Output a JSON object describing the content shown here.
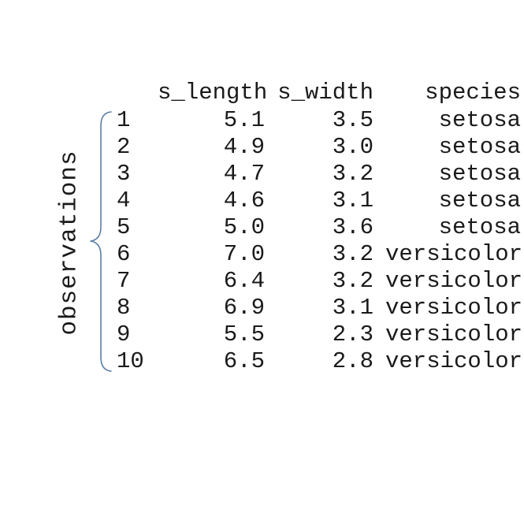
{
  "side_label": "observations",
  "columns": {
    "s_length": "s_length",
    "s_width": "s_width",
    "species": "species"
  },
  "rows": [
    {
      "index": "1",
      "s_length": "5.1",
      "s_width": "3.5",
      "species": "setosa"
    },
    {
      "index": "2",
      "s_length": "4.9",
      "s_width": "3.0",
      "species": "setosa"
    },
    {
      "index": "3",
      "s_length": "4.7",
      "s_width": "3.2",
      "species": "setosa"
    },
    {
      "index": "4",
      "s_length": "4.6",
      "s_width": "3.1",
      "species": "setosa"
    },
    {
      "index": "5",
      "s_length": "5.0",
      "s_width": "3.6",
      "species": "setosa"
    },
    {
      "index": "6",
      "s_length": "7.0",
      "s_width": "3.2",
      "species": "versicolor"
    },
    {
      "index": "7",
      "s_length": "6.4",
      "s_width": "3.2",
      "species": "versicolor"
    },
    {
      "index": "8",
      "s_length": "6.9",
      "s_width": "3.1",
      "species": "versicolor"
    },
    {
      "index": "9",
      "s_length": "5.5",
      "s_width": "2.3",
      "species": "versicolor"
    },
    {
      "index": "10",
      "s_length": "6.5",
      "s_width": "2.8",
      "species": "versicolor"
    }
  ],
  "colors": {
    "brace": "#5b7fa6",
    "text": "#1a1a1a"
  }
}
